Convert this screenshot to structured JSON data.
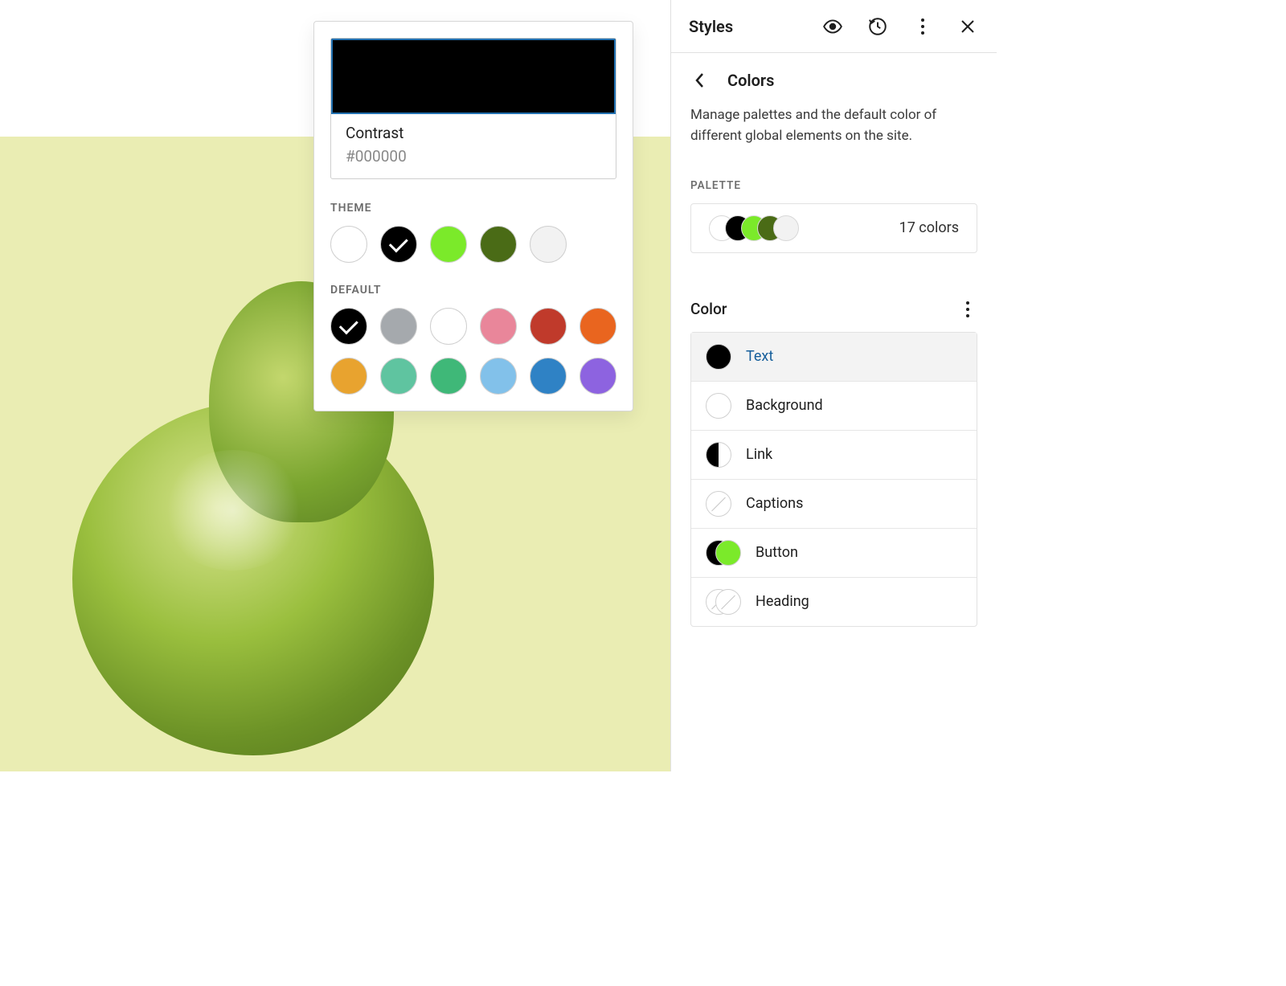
{
  "sidebar": {
    "title": "Styles",
    "crumb_title": "Colors",
    "description": "Manage palettes and the default color of different global elements on the site.",
    "palette_label": "PALETTE",
    "palette_count_label": "17 colors",
    "palette_preview_colors": [
      "#ffffff",
      "#000000",
      "#7bea2a",
      "#4a6b16",
      "#f2f2f2"
    ],
    "color_section_title": "Color",
    "color_items": [
      {
        "label": "Text",
        "kind": "solid",
        "color": "#000000",
        "active": true
      },
      {
        "label": "Background",
        "kind": "empty"
      },
      {
        "label": "Link",
        "kind": "split",
        "left": "#000000",
        "right": "#ffffff"
      },
      {
        "label": "Captions",
        "kind": "slash"
      },
      {
        "label": "Button",
        "kind": "pair",
        "c1": "#000000",
        "c2": "#7bea2a"
      },
      {
        "label": "Heading",
        "kind": "double-slash"
      }
    ]
  },
  "popover": {
    "preview_color": "#000000",
    "preview_name": "Contrast",
    "preview_hex": "#000000",
    "theme_label": "THEME",
    "theme_swatches": [
      {
        "color": "#ffffff",
        "selected": false
      },
      {
        "color": "#000000",
        "selected": true
      },
      {
        "color": "#7bea2a",
        "selected": false
      },
      {
        "color": "#4a6b16",
        "selected": false
      },
      {
        "color": "#f2f2f2",
        "selected": false
      }
    ],
    "default_label": "DEFAULT",
    "default_swatches": [
      {
        "color": "#000000",
        "selected": true
      },
      {
        "color": "#a5a9ad",
        "selected": false
      },
      {
        "color": "#ffffff",
        "selected": false
      },
      {
        "color": "#e9869a",
        "selected": false
      },
      {
        "color": "#c03a2b",
        "selected": false
      },
      {
        "color": "#e9651f",
        "selected": false
      },
      {
        "color": "#e8a32f",
        "selected": false
      },
      {
        "color": "#5fc4a0",
        "selected": false
      },
      {
        "color": "#3fb878",
        "selected": false
      },
      {
        "color": "#82c1ea",
        "selected": false
      },
      {
        "color": "#2f82c5",
        "selected": false
      },
      {
        "color": "#8d63e0",
        "selected": false
      }
    ]
  }
}
